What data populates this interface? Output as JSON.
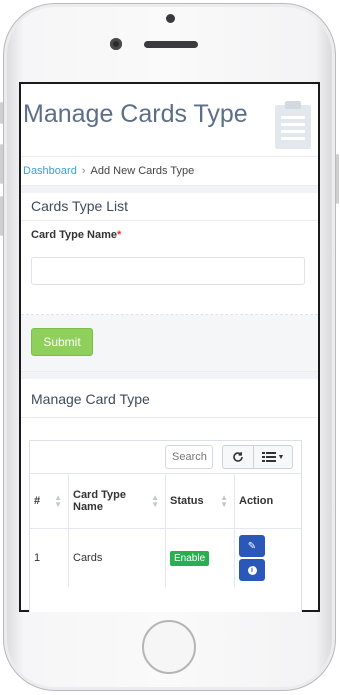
{
  "header": {
    "title": "Manage Cards Type",
    "icon": "clipboard-icon"
  },
  "breadcrumb": {
    "link": "Dashboard",
    "separator": "›",
    "current": "Add New Cards Type"
  },
  "form_panel": {
    "heading": "Cards Type List",
    "field_label": "Card Type Name",
    "required_mark": "*",
    "input_value": "",
    "submit_label": "Submit"
  },
  "table_panel": {
    "heading": "Manage Card Type",
    "search_placeholder": "Search",
    "columns": [
      "#",
      "Card Type Name",
      "Status",
      "Action"
    ],
    "rows": [
      {
        "index": "1",
        "name": "Cards",
        "status": "Enable"
      }
    ]
  },
  "colors": {
    "accent_link": "#3aa0d8",
    "submit": "#8fcf5c",
    "status_enable": "#27b04f",
    "action_button": "#2a58b8"
  }
}
